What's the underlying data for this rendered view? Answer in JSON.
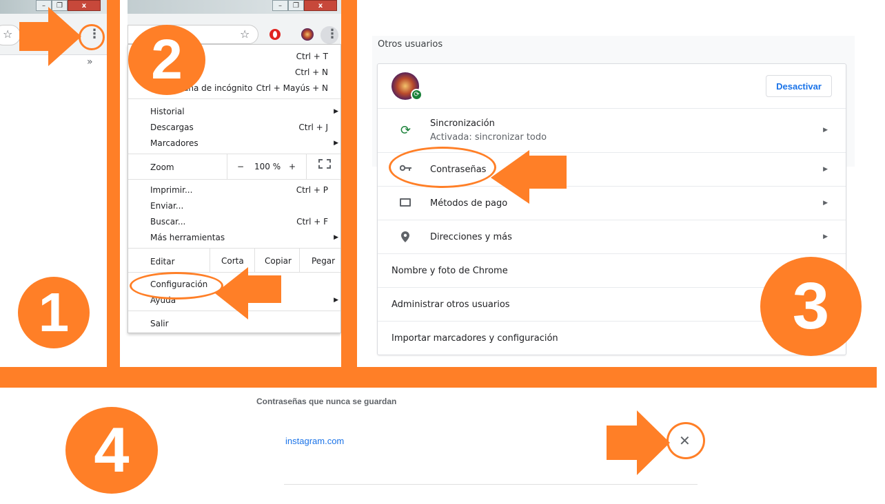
{
  "steps": {
    "one": "1",
    "two": "2",
    "three": "3",
    "four": "4"
  },
  "panel1": {
    "win_minimize": "–",
    "win_restore": "❐",
    "win_close": "x",
    "overflow": "»"
  },
  "panel2": {
    "win_minimize": "–",
    "win_restore": "❐",
    "win_close": "x",
    "menu": {
      "new_tab_shortcut": "Ctrl + T",
      "new_window_shortcut": "Ctrl + N",
      "incognito_partial": "ana de incógnito",
      "incognito_shortcut": "Ctrl + Mayús + N",
      "history": "Historial",
      "downloads": "Descargas",
      "downloads_shortcut": "Ctrl + J",
      "bookmarks": "Marcadores",
      "zoom": "Zoom",
      "zoom_minus": "−",
      "zoom_value": "100 %",
      "zoom_plus": "+",
      "print": "Imprimir...",
      "print_shortcut": "Ctrl + P",
      "cast": "Enviar...",
      "find": "Buscar...",
      "find_shortcut": "Ctrl + F",
      "more_tools": "Más herramientas",
      "edit": "Editar",
      "cut": "Corta",
      "copy": "Copiar",
      "paste": "Pegar",
      "settings": "Configuración",
      "help": "Ayuda",
      "exit": "Salir"
    }
  },
  "panel3": {
    "section_title": "Otros usuarios",
    "deactivate_button": "Desactivar",
    "sync_label": "Sincronización",
    "sync_status": "Activada: sincronizar todo",
    "passwords": "Contraseñas",
    "payment_methods": "Métodos de pago",
    "addresses": "Direcciones y más",
    "chrome_name_photo": "Nombre y foto de Chrome",
    "manage_users": "Administrar otros usuarios",
    "import": "Importar marcadores y configuración"
  },
  "panel4": {
    "title": "Contraseñas que nunca se guardan",
    "site": "instagram.com"
  },
  "colors": {
    "orange": "#ff7f27",
    "link_blue": "#1a73e8",
    "sync_green": "#188038"
  }
}
